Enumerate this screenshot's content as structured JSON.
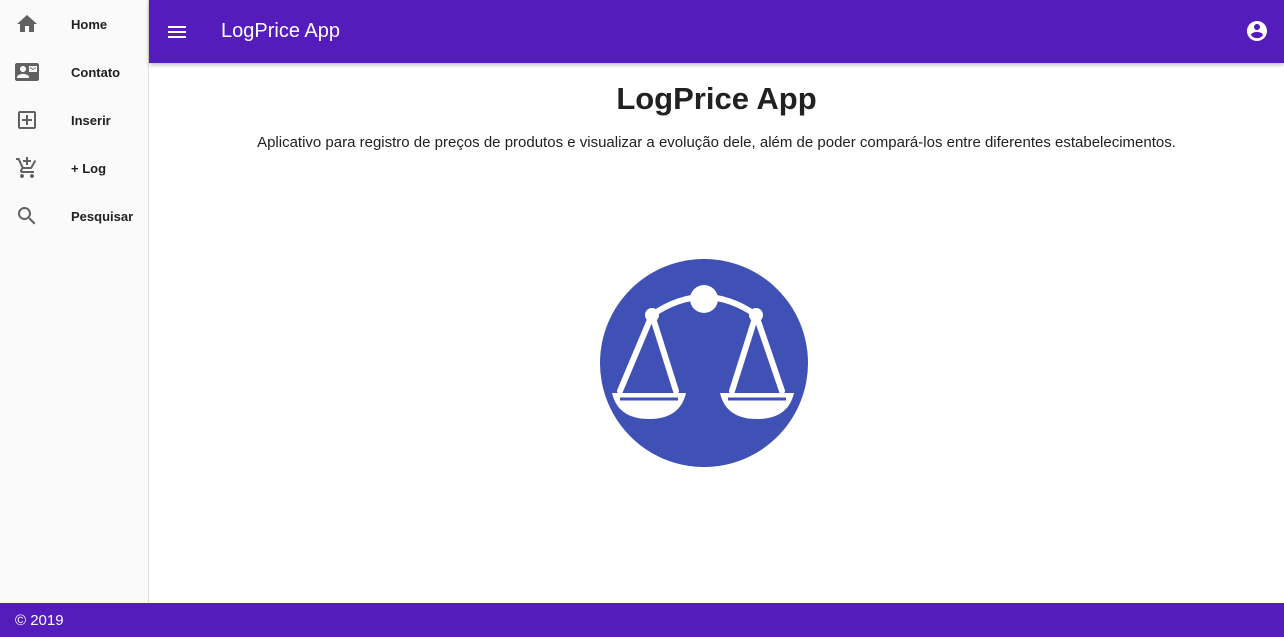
{
  "colors": {
    "primary": "#531cbb",
    "logo_circle": "#3f51b5",
    "logo_symbol": "#ffffff",
    "sidebar_bg": "#fafafa"
  },
  "sidebar": {
    "items": [
      {
        "label": "Home",
        "icon": "home-icon"
      },
      {
        "label": "Contato",
        "icon": "contact-mail-icon"
      },
      {
        "label": "Inserir",
        "icon": "add-box-icon"
      },
      {
        "label": "+ Log",
        "icon": "add-shopping-cart-icon"
      },
      {
        "label": "Pesquisar",
        "icon": "search-icon"
      }
    ]
  },
  "header": {
    "title": "LogPrice App",
    "menu_icon": "menu-icon",
    "account_icon": "account-circle-icon"
  },
  "main": {
    "title": "LogPrice App",
    "description": "Aplicativo para registro de preços de produtos e visualizar a evolução dele, além de poder compará-los entre diferentes estabelecimentos.",
    "logo_icon": "balance-scale-icon"
  },
  "footer": {
    "text": "© 2019"
  }
}
